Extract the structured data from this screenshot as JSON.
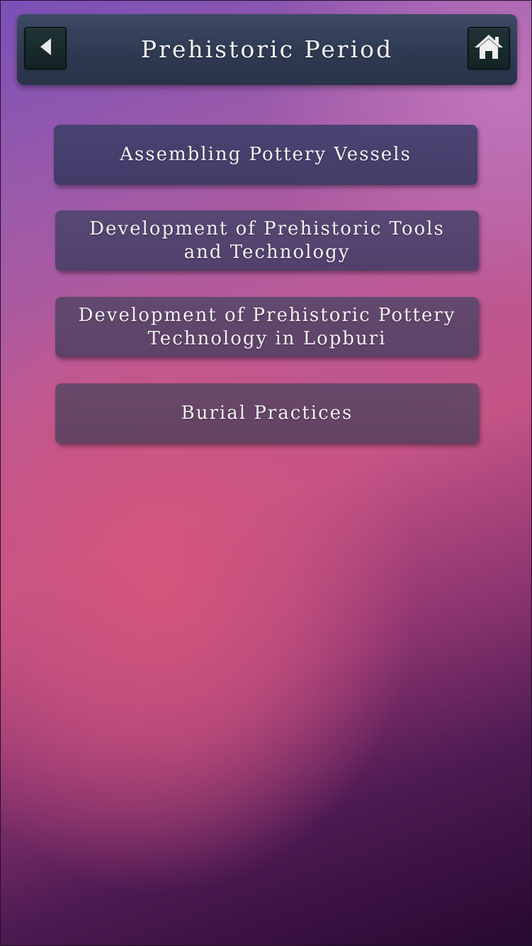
{
  "header": {
    "title": "Prehistoric Period",
    "back_icon": "back-arrow-icon",
    "home_icon": "home-icon"
  },
  "menu": {
    "items": [
      {
        "label": "Assembling Pottery Vessels"
      },
      {
        "label": "Development of Prehistoric Tools and Technology"
      },
      {
        "label": "Development of Prehistoric Pottery Technology in Lopburi"
      },
      {
        "label": "Burial Practices"
      }
    ]
  },
  "colors": {
    "header_bg": "#323d55",
    "button_bg": "#1a2b2e",
    "text": "#f2f2f2"
  }
}
